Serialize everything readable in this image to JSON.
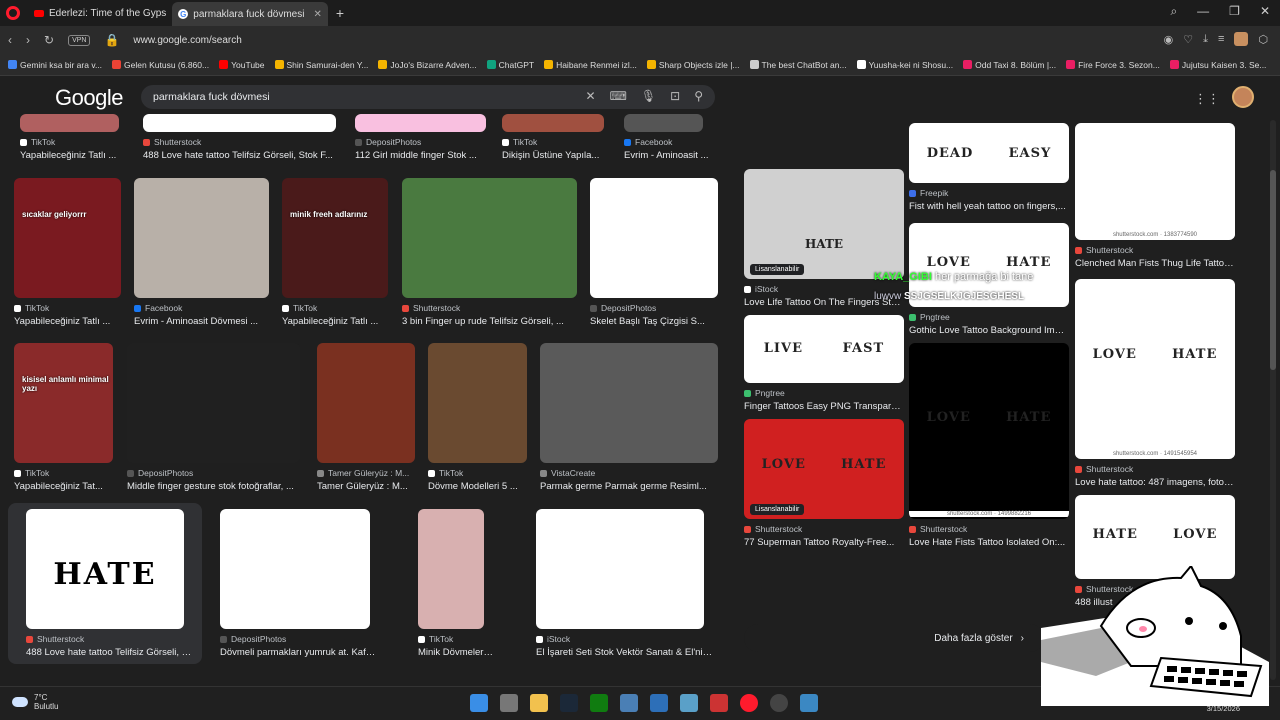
{
  "browser": {
    "tabs": [
      {
        "label": "Ederlezi: Time of the Gyps",
        "active": false
      },
      {
        "label": "parmaklara fuck dövmesi",
        "active": true
      }
    ],
    "url": "www.google.com/search",
    "vpn_label": "VPN"
  },
  "bookmarks": [
    "Gemini ksa bir ara v...",
    "Gelen Kutusu (6.860...",
    "YouTube",
    "Shin Samurai-den Y...",
    "JoJo's Bizarre Adven...",
    "ChatGPT",
    "Haibane Renmei izl...",
    "Sharp Objects izle |...",
    "The best ChatBot an...",
    "Yuusha-kei ni Shosu...",
    "Odd Taxi 8. Bölüm |...",
    "Fire Force 3. Sezon...",
    "Jujutsu Kaisen 3. Se..."
  ],
  "google": {
    "logo": "Google",
    "query": "parmaklara fuck dövmesi"
  },
  "results_row0": [
    {
      "source": "TikTok",
      "title": "Yapabileceğiniz Tatlı ..."
    },
    {
      "source": "Shutterstock",
      "title": "488 Love hate tattoo Telifsiz Görseli, Stok F..."
    },
    {
      "source": "DepositPhotos",
      "title": "112 Girl middle finger Stok ..."
    },
    {
      "source": "TikTok",
      "title": "Dikişin Üstüne Yapıla..."
    },
    {
      "source": "Facebook",
      "title": "Evrim - Aminoasit ..."
    }
  ],
  "results_row1": [
    {
      "source": "TikTok",
      "title": "Yapabileceğiniz Tatlı ...",
      "overlay": "sıcaklar geliyorrr"
    },
    {
      "source": "Facebook",
      "title": "Evrim - Aminoasit Dövmesi ..."
    },
    {
      "source": "TikTok",
      "title": "Yapabileceğiniz Tatlı ...",
      "overlay": "minik freeh adlarınız"
    },
    {
      "source": "Shutterstock",
      "title": "3 bin Finger up rude Telifsiz Görseli, ..."
    },
    {
      "source": "DepositPhotos",
      "title": "Skelet Başlı Taş Çizgisi S..."
    }
  ],
  "results_row2": [
    {
      "source": "TikTok",
      "title": "Yapabileceğiniz Tat...",
      "overlay": "kisisel anlamlı minimal yazı"
    },
    {
      "source": "DepositPhotos",
      "title": "Middle finger gesture stok fotoğraflar, ..."
    },
    {
      "source": "Tamer Güleryüz : M...",
      "title": "Tamer Güleryüz : M..."
    },
    {
      "source": "TikTok",
      "title": "Dövme Modelleri 5 ..."
    },
    {
      "source": "VistaCreate",
      "title": "Parmak germe Parmak germe Resiml..."
    }
  ],
  "results_row3": [
    {
      "source": "Shutterstock",
      "title": "488 Love hate tattoo Telifsiz Görseli, St...",
      "word": "HATE"
    },
    {
      "source": "DepositPhotos",
      "title": "Dövmeli parmakları yumruk at. Kafat..."
    },
    {
      "source": "TikTok",
      "title": "Minik Dövmeler | TikTok"
    },
    {
      "source": "iStock",
      "title": "El İşareti Seti Stok Vektör Sanatı & El'nin ..."
    }
  ],
  "side_panel": {
    "col1": [
      {
        "source": "iStock",
        "title": "Love Life Tattoo On The Fingers Stok...",
        "badge": "Lisanslanabilir",
        "word": "HATE"
      },
      {
        "source": "Pngtree",
        "title": "Finger Tattoos Easy PNG Transparent...",
        "words": [
          "LIVE",
          "FAST"
        ]
      },
      {
        "source": "Shutterstock",
        "title": "77 Superman Tattoo Royalty-Free...",
        "badge": "Lisanslanabilir",
        "words": [
          "LOVE",
          "HATE"
        ]
      }
    ],
    "col2": [
      {
        "source": "Freepik",
        "title": "Fist with hell yeah tattoo on fingers,...",
        "words": [
          "DEAD",
          "EASY"
        ]
      },
      {
        "source": "Pngtree",
        "title": "Gothic Love Tattoo Background Images...",
        "words": [
          "LOVE",
          "HATE"
        ]
      },
      {
        "source": "Shutterstock",
        "title": "Love Hate Fists Tattoo Isolated On:...",
        "words": [
          "LOVE",
          "HATE"
        ],
        "watermark": "shutterstock.com · 1499882216"
      }
    ],
    "col3": [
      {
        "source": "Shutterstock",
        "title": "Clenched Man Fists Thug Life Tattoo...",
        "watermark": "shutterstock.com · 1383774590"
      },
      {
        "source": "Shutterstock",
        "title": "Love hate tattoo: 487 imagens, fotos e...",
        "words": [
          "LOVE",
          "HATE"
        ],
        "watermark": "shutterstock.com · 1491545954"
      },
      {
        "source": "Shutterstock",
        "title": "488 illust",
        "words": [
          "HATE",
          "LOVE"
        ]
      }
    ],
    "more_button": "Daha fazla göster",
    "close": "✕"
  },
  "stream_overlay": {
    "user": "KAYA_GIBI",
    "message": "her parmağa bi tane",
    "user2": "luwvw",
    "message2": "SSJGSELKJGJESGHESL"
  },
  "taskbar": {
    "temp": "7°C",
    "weather": "Bulutlu",
    "date": "3/15/2026"
  },
  "colors": {
    "shutterstock": "#e8473c",
    "tiktok": "#ffffff",
    "facebook": "#1877f2",
    "depositphotos": "#555555",
    "istock": "#ffffff",
    "pngtree": "#3cbf6e",
    "freepik": "#3c6eea"
  }
}
